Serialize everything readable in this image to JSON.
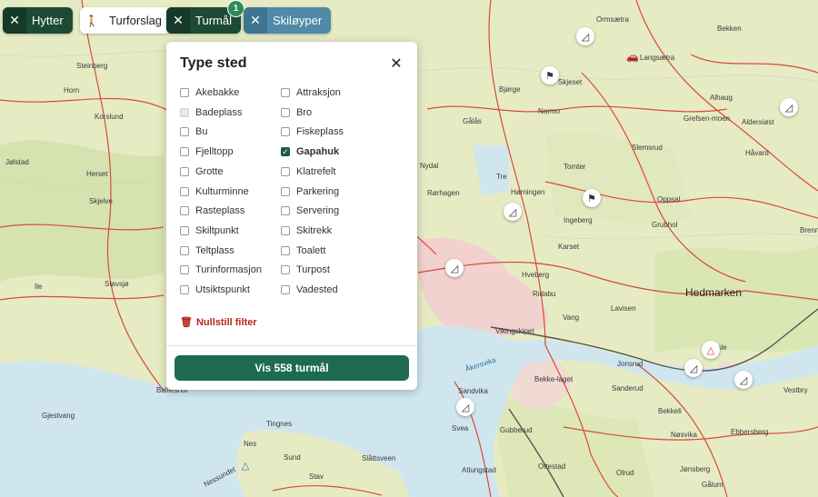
{
  "chips": {
    "hytter": {
      "label": "Hytter",
      "remove": "✕"
    },
    "turforslag": {
      "label": "Turforslag",
      "icon": "hiker-icon"
    },
    "turmal": {
      "label": "Turmål",
      "remove": "✕",
      "badge": "1"
    },
    "skiloyper": {
      "label": "Skiløyper",
      "remove": "✕"
    }
  },
  "panel": {
    "title": "Type sted",
    "close": "✕",
    "options_left": [
      {
        "label": "Akebakke",
        "checked": false
      },
      {
        "label": "Badeplass",
        "checked": false,
        "disabled": true
      },
      {
        "label": "Bu",
        "checked": false
      },
      {
        "label": "Fjelltopp",
        "checked": false
      },
      {
        "label": "Grotte",
        "checked": false
      },
      {
        "label": "Kulturminne",
        "checked": false
      },
      {
        "label": "Rasteplass",
        "checked": false
      },
      {
        "label": "Skiltpunkt",
        "checked": false
      },
      {
        "label": "Teltplass",
        "checked": false
      },
      {
        "label": "Turinformasjon",
        "checked": false
      },
      {
        "label": "Utsiktspunkt",
        "checked": false
      }
    ],
    "options_right": [
      {
        "label": "Attraksjon",
        "checked": false
      },
      {
        "label": "Bro",
        "checked": false
      },
      {
        "label": "Fiskeplass",
        "checked": false
      },
      {
        "label": "Gapahuk",
        "checked": true
      },
      {
        "label": "Klatrefelt",
        "checked": false
      },
      {
        "label": "Parkering",
        "checked": false
      },
      {
        "label": "Servering",
        "checked": false
      },
      {
        "label": "Skitrekk",
        "checked": false
      },
      {
        "label": "Toalett",
        "checked": false
      },
      {
        "label": "Turpost",
        "checked": false
      },
      {
        "label": "Vadested",
        "checked": false
      }
    ],
    "reset_label": "Nullstill filter",
    "show_button": "Vis 558 turmål"
  },
  "map_labels": [
    "Steinberg",
    "Horn",
    "Korslund",
    "Jølstad",
    "Herset",
    "Skjelve",
    "Stavsjø",
    "Ile",
    "Ballieshol",
    "Gjestvang",
    "Tingnes",
    "Nes",
    "Sund",
    "Stav",
    "Slåttsveen",
    "Nessundet",
    "Bjørge",
    "Narmo",
    "Gålås",
    "Nydal",
    "Tre",
    "Rørhagen",
    "Hørningen",
    "Ingeberg",
    "Karset",
    "Hveberg",
    "Ridabu",
    "Vang",
    "Vikingskipet",
    "Åkersvika",
    "Sandvika",
    "Svea",
    "Gubberud",
    "Bekke-laget",
    "Ottestad",
    "Atlungstad",
    "Skjeset",
    "Langsætra",
    "Ormsætra",
    "Bekken",
    "Alhaug",
    "Grefsen-moen",
    "Aldersiøst",
    "Slemsrud",
    "Tomter",
    "Oppsal",
    "Grubhol",
    "Håvard",
    "Brenn",
    "Hedmarken",
    "Lavisen",
    "Veksle",
    "Jonsrud",
    "Sanderud",
    "Vestbry",
    "Gålum",
    "Olrud",
    "Jønsberg",
    "Ebbersberg",
    "Nøsvika",
    "Bekkeli"
  ],
  "colors": {
    "accent": "#1f6b52",
    "reset": "#b3261e",
    "chip_dark": "#1d4a36",
    "chip_blue": "#4f8aa6"
  }
}
